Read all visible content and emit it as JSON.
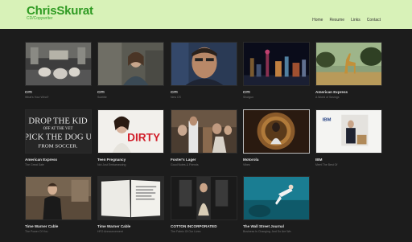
{
  "header": {
    "name": "ChrisSkurat",
    "tagline": "CD/Copywriter",
    "nav": [
      "Home",
      "Resume",
      "Links",
      "Contact"
    ]
  },
  "projects": [
    {
      "title": "CITI",
      "sub": "What's Your Wind?"
    },
    {
      "title": "CITI",
      "sub": "Subtitle"
    },
    {
      "title": "CITI",
      "sub": "New CS"
    },
    {
      "title": "CITI",
      "sub": "Shotgun"
    },
    {
      "title": "American Express",
      "sub": "A World of Savings"
    },
    {
      "title": "American Express",
      "sub": "The Great Sale"
    },
    {
      "title": "Teen Pregnancy",
      "sub": "Not Just Embarrassing"
    },
    {
      "title": "Foster's Lager",
      "sub": "Good Notes & Friends"
    },
    {
      "title": "Motorola",
      "sub": "Vibes"
    },
    {
      "title": "IBM",
      "sub": "Meet The Best Of"
    },
    {
      "title": "Time Warner Cable",
      "sub": "The Power Of You"
    },
    {
      "title": "Time Warner Cable",
      "sub": "HFO Announcement"
    },
    {
      "title": "COTTON INCORPORATED",
      "sub": "The Fabric Of Our Lives"
    },
    {
      "title": "The Wall Street Journal",
      "sub": "Business Is Changing. And So Are We."
    }
  ],
  "thumb_text": {
    "amex_line1": "DROP THE KID",
    "amex_line2": "OFF AT THE VET",
    "amex_line3": "PICK THE DOG U",
    "amex_line4": "FROM SOCCER.",
    "teen_dirty": "DIRTY",
    "ibm_logo": "IBM"
  }
}
